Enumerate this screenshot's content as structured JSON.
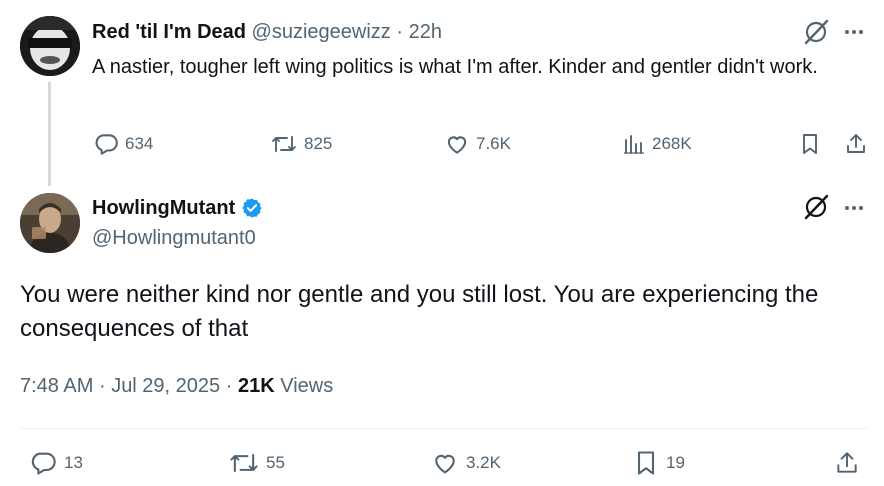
{
  "parent_tweet": {
    "display_name": "Red 'til I'm Dead",
    "handle": "@suziegeewizz",
    "separator": "·",
    "time": "22h",
    "text": "A nastier, tougher left wing politics is what I'm after. Kinder and gentler didn't work.",
    "replies": "634",
    "reposts": "825",
    "likes": "7.6K",
    "views": "268K",
    "icons": [
      "reply-icon",
      "repost-icon",
      "like-icon",
      "views-icon",
      "bookmark-icon",
      "share-icon",
      "grok-icon",
      "more-icon"
    ]
  },
  "main_tweet": {
    "display_name": "HowlingMutant",
    "handle": "@Howlingmutant0",
    "verified": true,
    "text": "You were neither kind nor gentle and you still lost.  You are experiencing the consequences of that",
    "time": "7:48 AM",
    "date": "Jul 29, 2025",
    "sep": "·",
    "views_count": "21K",
    "views_label": "Views",
    "replies": "13",
    "reposts": "55",
    "likes": "3.2K",
    "bookmarks": "19",
    "icons": [
      "reply-icon",
      "repost-icon",
      "like-icon",
      "bookmark-icon",
      "share-icon",
      "grok-icon",
      "more-icon"
    ]
  },
  "colors": {
    "text_primary": "#0f1419",
    "text_secondary": "#536471",
    "verified_blue": "#1d9bf0",
    "thread_line": "#cfd9de",
    "divider": "#eff3f4"
  }
}
